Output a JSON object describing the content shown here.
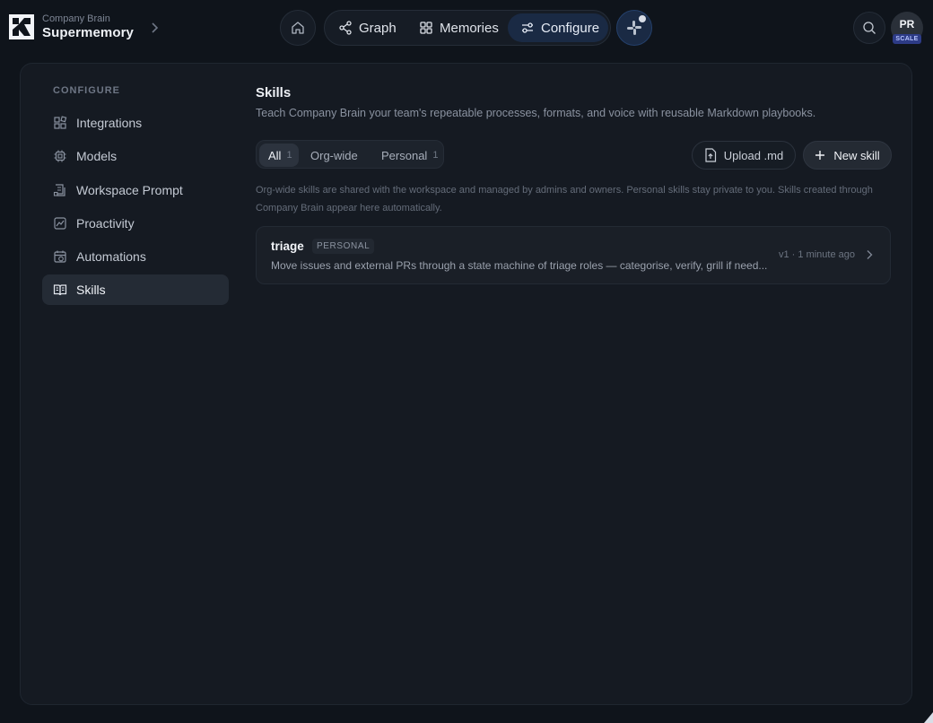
{
  "brand": {
    "subtitle": "Company Brain",
    "name": "Supermemory"
  },
  "nav": {
    "graph_label": "Graph",
    "memories_label": "Memories",
    "configure_label": "Configure",
    "active": "Configure"
  },
  "user": {
    "initials": "PR",
    "plan": "SCALE"
  },
  "sidebar": {
    "heading": "CONFIGURE",
    "items": [
      {
        "label": "Integrations",
        "icon": "integrations-icon"
      },
      {
        "label": "Models",
        "icon": "chip-icon"
      },
      {
        "label": "Workspace Prompt",
        "icon": "prompt-icon"
      },
      {
        "label": "Proactivity",
        "icon": "proactivity-icon"
      },
      {
        "label": "Automations",
        "icon": "calendar-clock-icon"
      },
      {
        "label": "Skills",
        "icon": "book-icon"
      }
    ],
    "active": "Skills"
  },
  "skills_page": {
    "title": "Skills",
    "description": "Teach Company Brain your team's repeatable processes, formats, and voice with reusable Markdown playbooks.",
    "tabs": [
      {
        "label": "All",
        "count": "1"
      },
      {
        "label": "Org-wide",
        "count": ""
      },
      {
        "label": "Personal",
        "count": "1"
      }
    ],
    "active_tab": "All",
    "upload_label": "Upload .md",
    "new_label": "New skill",
    "info": "Org-wide skills are shared with the workspace and managed by admins and owners. Personal skills stay private to you. Skills created through Company Brain appear here automatically.",
    "skills": [
      {
        "name": "triage",
        "badge": "PERSONAL",
        "description": "Move issues and external PRs through a state machine of triage roles — categorise, verify, grill if need...",
        "meta": "v1 · 1 minute ago"
      }
    ]
  },
  "colors": {
    "accent": "#1a2a44",
    "panel": "#151a22",
    "background": "#0f141b",
    "plan_badge": "#2d3b86"
  }
}
